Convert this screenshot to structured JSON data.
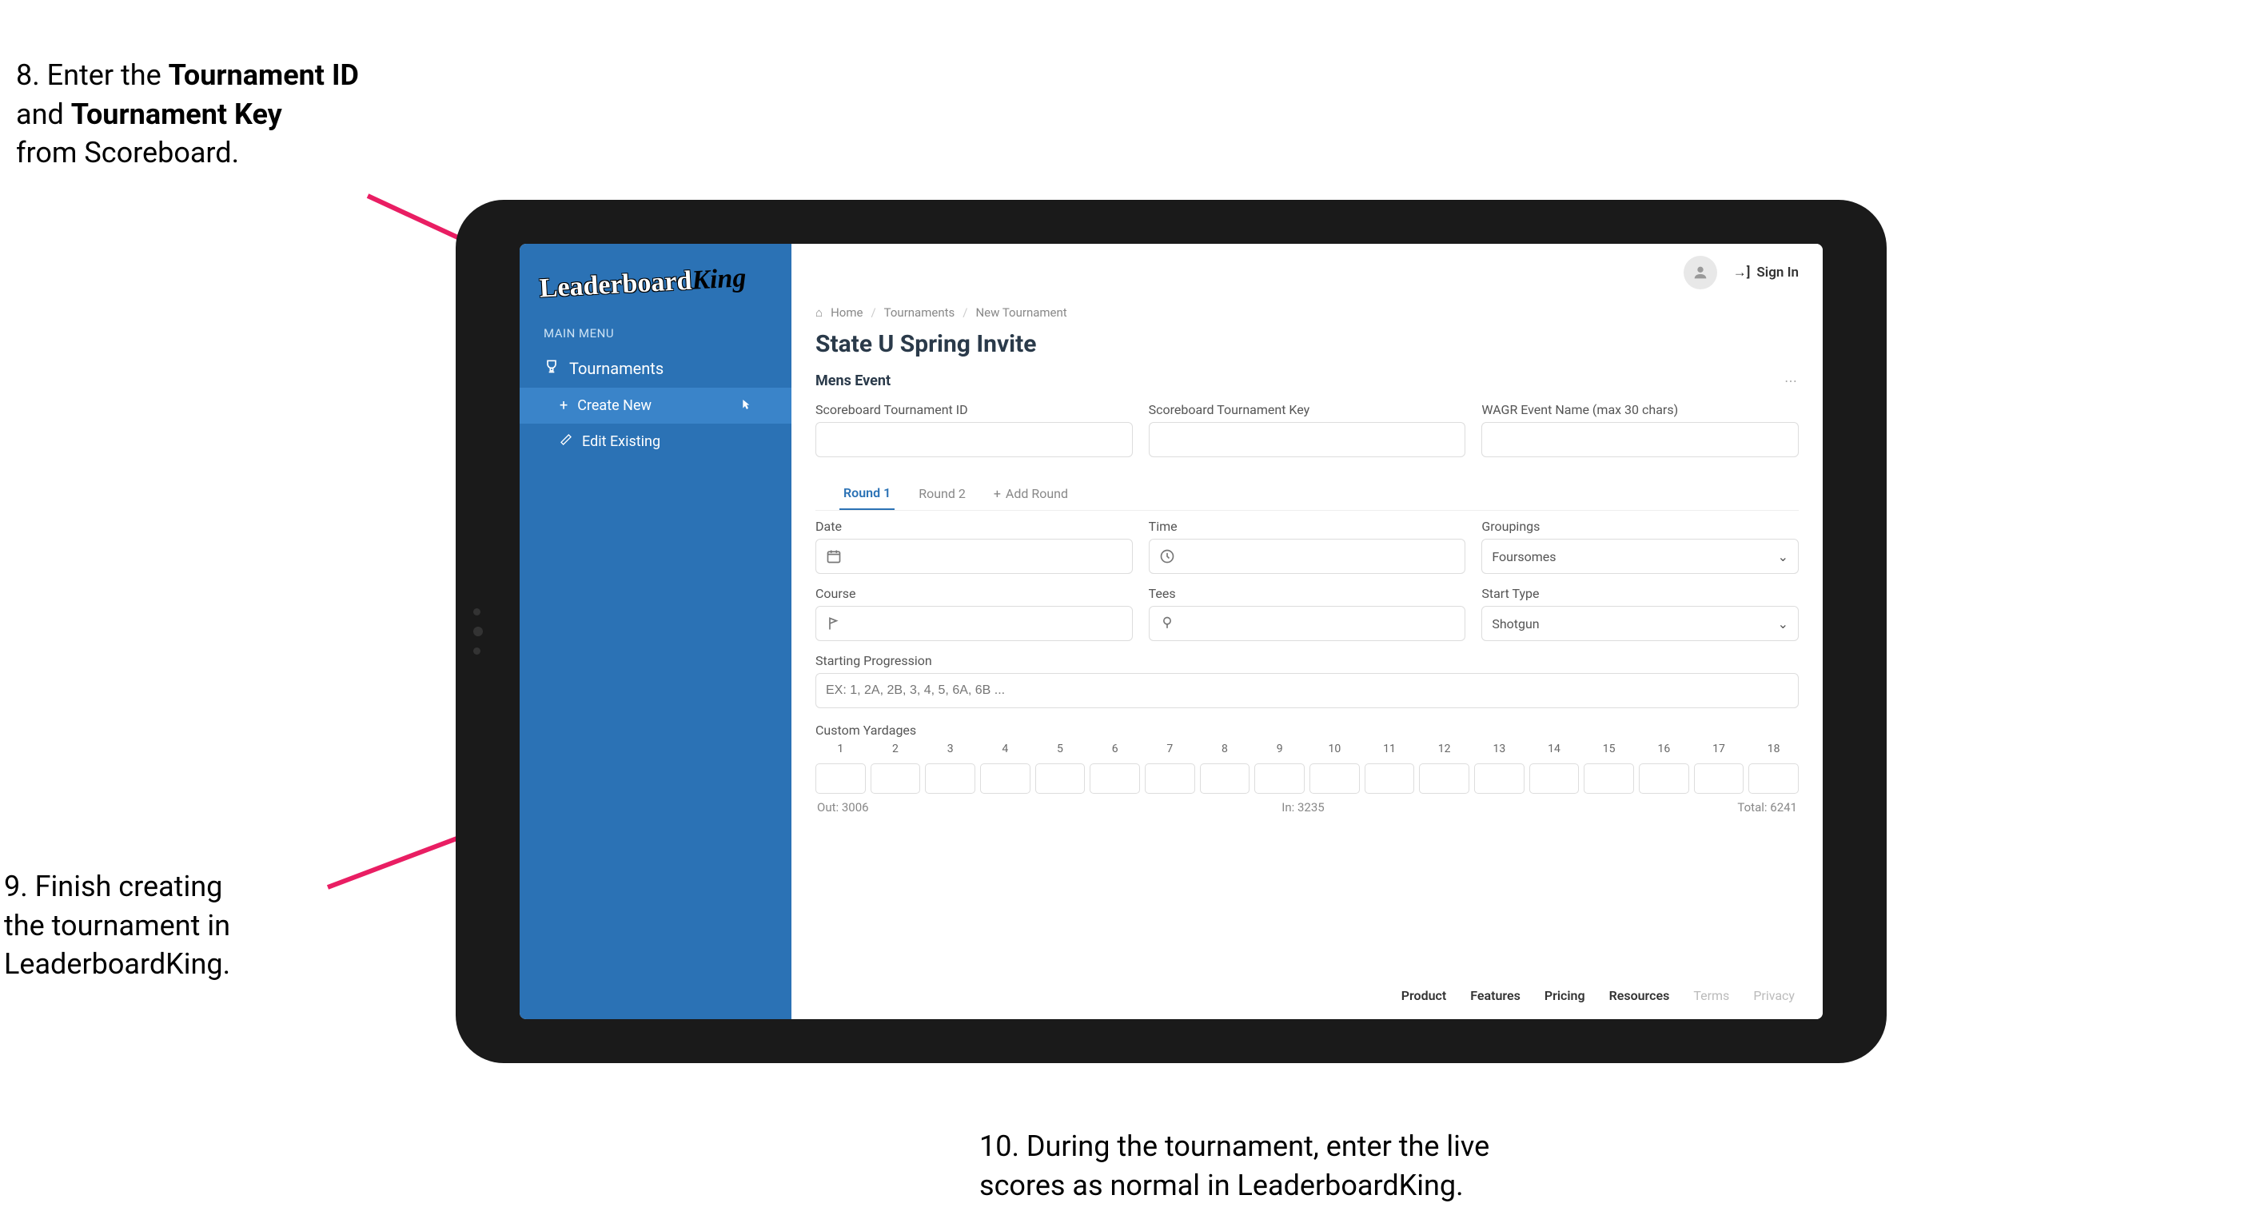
{
  "annotations": {
    "step8_line1": "8. Enter the ",
    "step8_bold1": "Tournament ID",
    "step8_line2": "and ",
    "step8_bold2": "Tournament Key",
    "step8_line3": "from Scoreboard.",
    "step9_line1": "9. Finish creating",
    "step9_line2": "the tournament in",
    "step9_line3": "LeaderboardKing.",
    "step10_line1": "10. During the tournament, enter the live",
    "step10_line2": "scores as normal in LeaderboardKing."
  },
  "sidebar": {
    "logo_part1": "Leaderboard",
    "logo_part2": "King",
    "main_menu": "MAIN MENU",
    "tournaments": "Tournaments",
    "create_new": "Create New",
    "edit_existing": "Edit Existing"
  },
  "topbar": {
    "signin": "Sign In"
  },
  "breadcrumb": {
    "home": "Home",
    "tournaments": "Tournaments",
    "new": "New Tournament"
  },
  "page": {
    "title": "State U Spring Invite",
    "event": "Mens Event"
  },
  "labels": {
    "sb_id": "Scoreboard Tournament ID",
    "sb_key": "Scoreboard Tournament Key",
    "wagr": "WAGR Event Name (max 30 chars)",
    "date": "Date",
    "time": "Time",
    "groupings": "Groupings",
    "course": "Course",
    "tees": "Tees",
    "start_type": "Start Type",
    "starting_prog": "Starting Progression",
    "custom_yardages": "Custom Yardages"
  },
  "tabs": {
    "round1": "Round 1",
    "round2": "Round 2",
    "add_round": "Add Round"
  },
  "values": {
    "groupings": "Foursomes",
    "start_type": "Shotgun",
    "starting_prog_placeholder": "EX: 1, 2A, 2B, 3, 4, 5, 6A, 6B ..."
  },
  "yardage": {
    "holes": [
      "1",
      "2",
      "3",
      "4",
      "5",
      "6",
      "7",
      "8",
      "9",
      "10",
      "11",
      "12",
      "13",
      "14",
      "15",
      "16",
      "17",
      "18"
    ],
    "out_label": "Out:",
    "out_value": "3006",
    "in_label": "In:",
    "in_value": "3235",
    "total_label": "Total:",
    "total_value": "6241"
  },
  "footer": {
    "product": "Product",
    "features": "Features",
    "pricing": "Pricing",
    "resources": "Resources",
    "terms": "Terms",
    "privacy": "Privacy"
  }
}
